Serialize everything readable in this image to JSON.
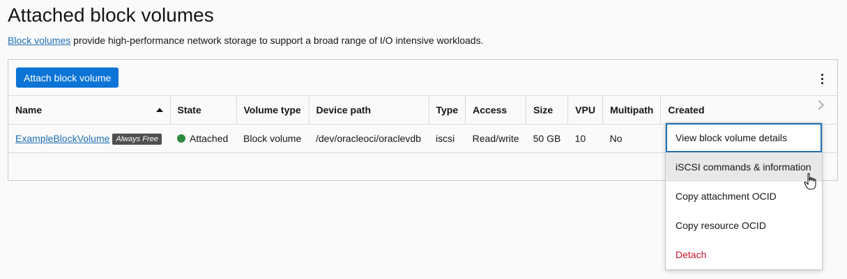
{
  "page": {
    "title": "Attached block volumes",
    "description_link": "Block volumes",
    "description_rest": " provide high-performance network storage to support a broad range of I/O intensive workloads."
  },
  "toolbar": {
    "attach_label": "Attach block volume"
  },
  "table": {
    "columns": [
      "Name",
      "State",
      "Volume type",
      "Device path",
      "Type",
      "Access",
      "Size",
      "VPU",
      "Multipath",
      "Created"
    ],
    "sorted_column": "Name",
    "sort_direction": "ascending",
    "rows": [
      {
        "name": "ExampleBlockVolume",
        "badge": "Always Free",
        "state": "Attached",
        "volume_type": "Block volume",
        "device_path": "/dev/oracleoci/oraclevdb",
        "type": "iscsi",
        "access": "Read/write",
        "size": "50 GB",
        "vpu": "10",
        "multipath": "No",
        "created": ""
      }
    ]
  },
  "actions_menu": {
    "items": [
      "View block volume details",
      "iSCSI commands & information",
      "Copy attachment OCID",
      "Copy resource OCID",
      "Detach"
    ]
  },
  "colors": {
    "primary": "#0c74d6",
    "link": "#1f6fb5",
    "status_ok": "#2e8b3e",
    "danger": "#c3122a",
    "badge_bg": "#4f4f4f"
  },
  "icons": [
    "sort-ascending-icon",
    "status-dot-icon",
    "kebab-menu-icon",
    "chevron-right-icon",
    "hand-pointer-cursor-icon"
  ]
}
